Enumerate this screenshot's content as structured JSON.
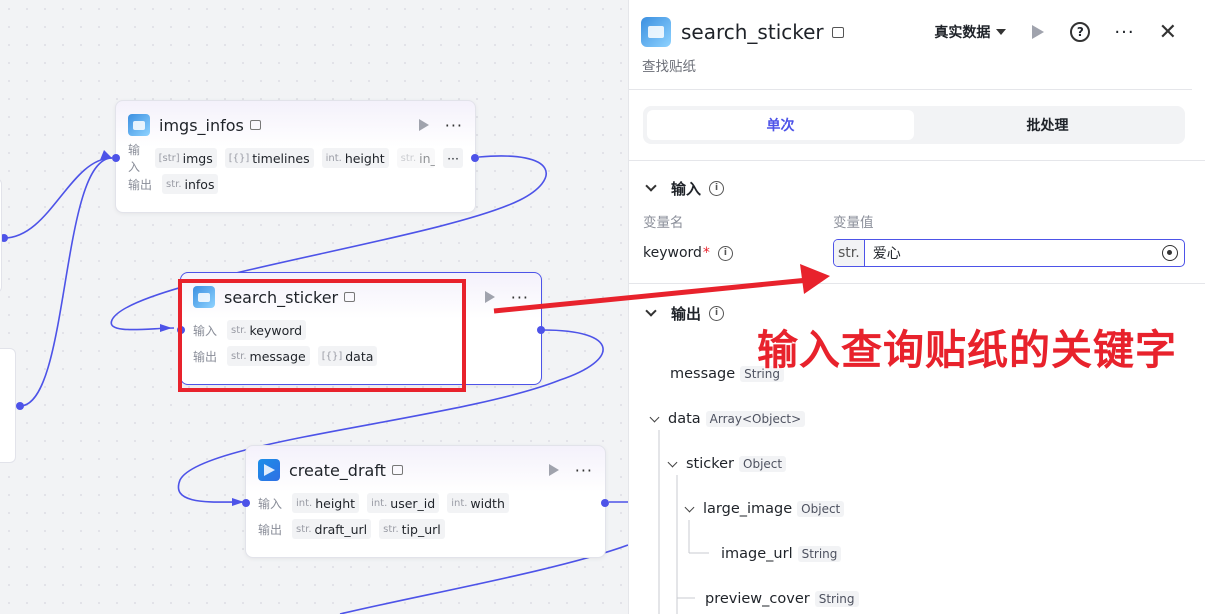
{
  "canvas": {
    "row_input_label": "输入",
    "row_output_label": "输出",
    "nodes": {
      "imgs_infos": {
        "title": "imgs_infos",
        "inputs": [
          {
            "type": "[str]",
            "name": "imgs"
          },
          {
            "type": "[{}]",
            "name": "timelines"
          },
          {
            "type": "int.",
            "name": "height"
          },
          {
            "type": "str.",
            "name": "in_ar"
          }
        ],
        "outputs": [
          {
            "type": "str.",
            "name": "infos"
          }
        ]
      },
      "search_sticker": {
        "title": "search_sticker",
        "inputs": [
          {
            "type": "str.",
            "name": "keyword"
          }
        ],
        "outputs": [
          {
            "type": "str.",
            "name": "message"
          },
          {
            "type": "[{}]",
            "name": "data"
          }
        ]
      },
      "create_draft": {
        "title": "create_draft",
        "inputs": [
          {
            "type": "int.",
            "name": "height"
          },
          {
            "type": "int.",
            "name": "user_id"
          },
          {
            "type": "int.",
            "name": "width"
          }
        ],
        "outputs": [
          {
            "type": "str.",
            "name": "draft_url"
          },
          {
            "type": "str.",
            "name": "tip_url"
          }
        ]
      }
    }
  },
  "panel": {
    "title": "search_sticker",
    "description": "查找贴纸",
    "mode_select": "真实数据",
    "tabs": [
      "单次",
      "批处理"
    ],
    "active_tab": 0,
    "input_section": "输入",
    "col_name": "变量名",
    "col_value": "变量值",
    "keyword_label": "keyword",
    "required_mark": "*",
    "keyword_type": "str.",
    "keyword_value": "爱心",
    "output_section": "输出",
    "outputs": [
      {
        "name": "message",
        "type": "String"
      },
      {
        "name": "data",
        "type": "Array<Object>"
      },
      {
        "name": "sticker",
        "type": "Object"
      },
      {
        "name": "large_image",
        "type": "Object"
      },
      {
        "name": "image_url",
        "type": "String"
      },
      {
        "name": "preview_cover",
        "type": "String"
      }
    ]
  },
  "annotation": "输入查询贴纸的关键字",
  "colors": {
    "accent": "#4d53e8",
    "annotation_red": "#e8222c"
  }
}
